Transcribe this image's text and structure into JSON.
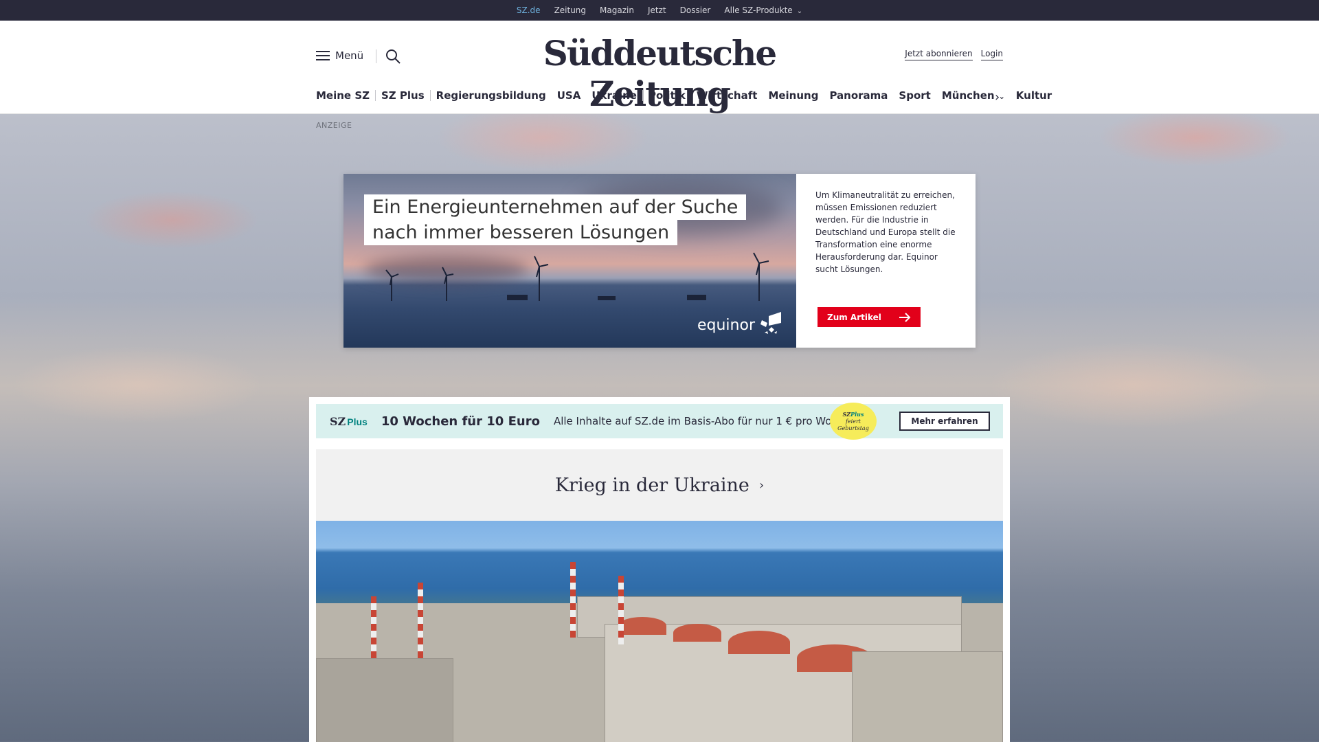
{
  "topbar": {
    "items": [
      "SZ.de",
      "Zeitung",
      "Magazin",
      "Jetzt",
      "Dossier",
      "Alle SZ-Produkte"
    ],
    "active": "SZ.de"
  },
  "header": {
    "menu_label": "Menü",
    "logo": "Süddeutsche Zeitung",
    "subscribe": "Jetzt abonnieren",
    "login": "Login"
  },
  "nav": {
    "items": [
      "Meine SZ",
      "SZ Plus",
      "Regierungsbildung",
      "USA",
      "Ukraine",
      "Politik",
      "Wirtschaft",
      "Meinung",
      "Panorama",
      "Sport",
      "München",
      "Kultur"
    ]
  },
  "ad": {
    "label": "ANZEIGE",
    "headline_line1": "Ein Energieunternehmen auf der Suche",
    "headline_line2": "nach immer besseren Lösungen",
    "brand": "equinor",
    "text": "Um Klimaneutralität zu erreichen, müssen Emissionen reduziert werden. Für die Industrie in Deutschland und Europa stellt die Transformation eine enorme Herausforderung dar. Equinor sucht Lösungen.",
    "button": "Zum Artikel"
  },
  "promo": {
    "brand_sz": "SZ",
    "brand_plus": "Plus",
    "headline": "10 Wochen für 10 Euro",
    "text": "Alle Inhalte auf SZ.de im Basis-Abo für nur 1 € pro Woche.",
    "badge_sz": "SZ",
    "badge_plus": "Plus",
    "badge_line1": "feiert",
    "badge_line2": "Geburtstag",
    "button": "Mehr erfahren"
  },
  "topic": {
    "title": "Krieg in der Ukraine"
  },
  "colors": {
    "topbar_bg": "#29293a",
    "active_link": "#6fb3e0",
    "ad_button": "#e2001a",
    "promo_bg": "#d9f0ee",
    "badge": "#f6ec5a"
  }
}
